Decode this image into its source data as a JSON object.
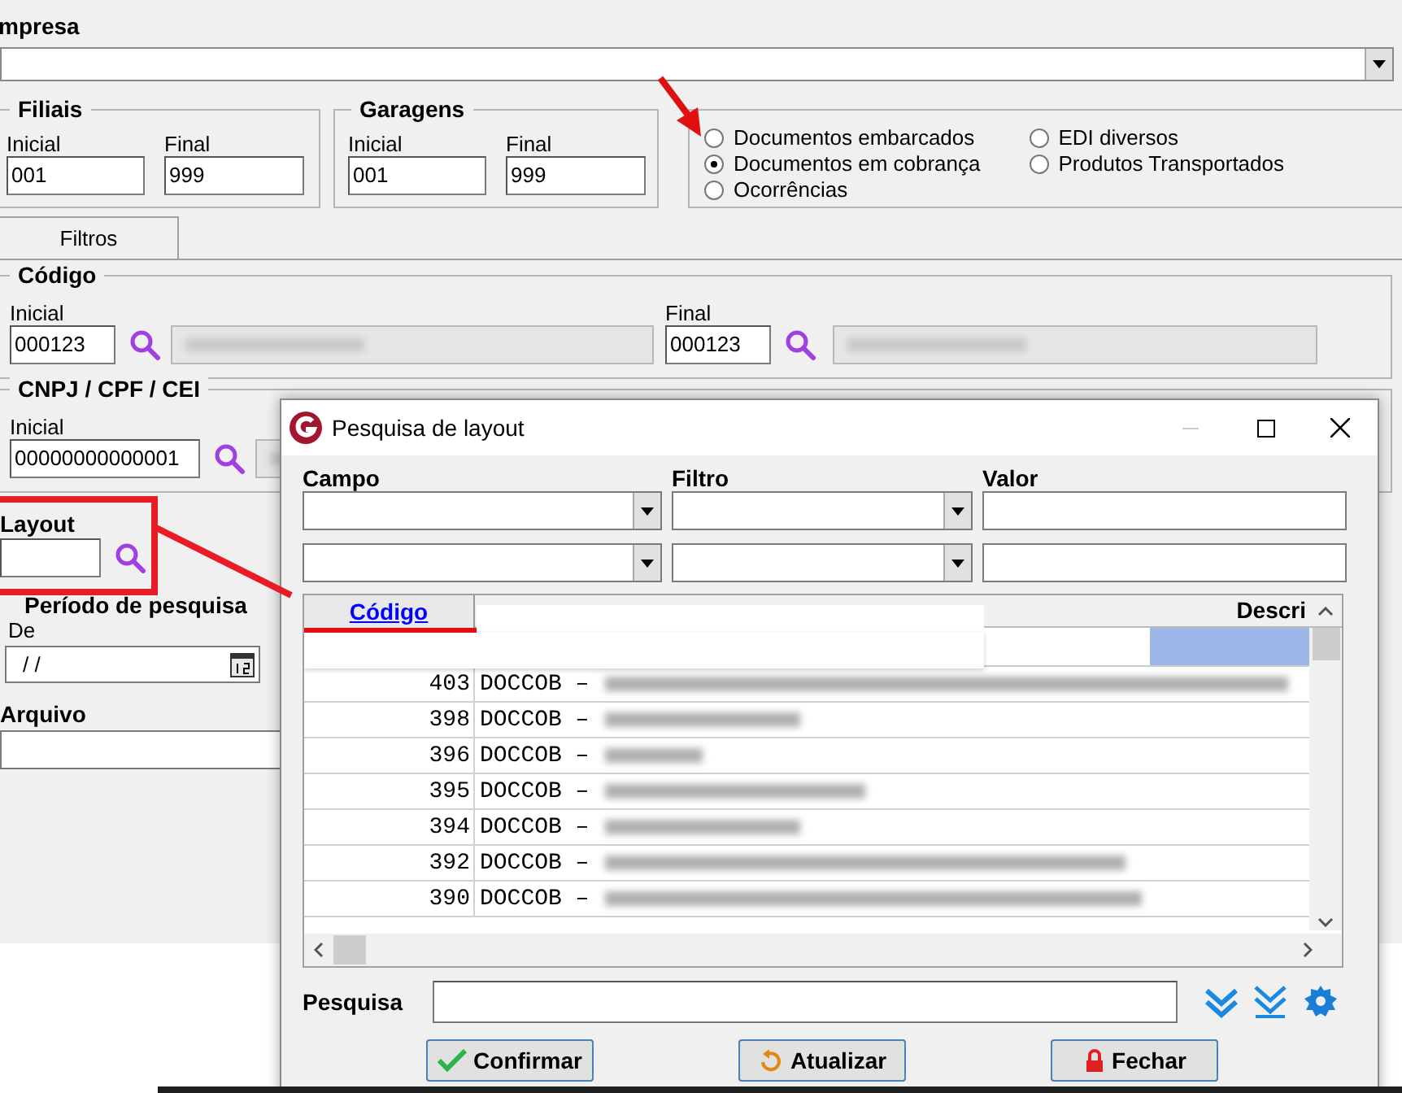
{
  "form": {
    "empresa_label": "mpresa",
    "filiais": {
      "title": "Filiais",
      "initial_label": "Inicial",
      "initial_value": "001",
      "final_label": "Final",
      "final_value": "999"
    },
    "garagens": {
      "title": "Garagens",
      "initial_label": "Inicial",
      "initial_value": "001",
      "final_label": "Final",
      "final_value": "999"
    },
    "document_types": [
      {
        "label": "Documentos embarcados",
        "selected": false
      },
      {
        "label": "Documentos em cobrança",
        "selected": true
      },
      {
        "label": "Ocorrências",
        "selected": false
      },
      {
        "label": "EDI diversos",
        "selected": false
      },
      {
        "label": "Produtos Transportados",
        "selected": false
      }
    ],
    "tabs": [
      {
        "label": "Filtros",
        "selected": true
      }
    ],
    "codigo": {
      "title": "Código",
      "initial_label": "Inicial",
      "initial_value": "000123",
      "final_label": "Final",
      "final_value": "000123"
    },
    "cnpj": {
      "title": "CNPJ / CPF / CEI",
      "initial_label": "Inicial",
      "initial_value": "00000000000001"
    },
    "layout": {
      "title": "Layout"
    },
    "periodo": {
      "title": "Período de pesquisa",
      "from_label": "De",
      "from_value": "/ /"
    },
    "arquivo": {
      "title": "Arquivo"
    }
  },
  "dialog": {
    "title": "Pesquisa de layout",
    "filter_labels": [
      "Campo",
      "Filtro",
      "Valor"
    ],
    "columns": [
      {
        "label": "Código",
        "sorted": true
      },
      {
        "label": "Descri",
        "sorted": false
      }
    ],
    "selected_row_visible": true,
    "rows": [
      {
        "code": "403",
        "description": "DOCCOB –"
      },
      {
        "code": "398",
        "description": "DOCCOB –"
      },
      {
        "code": "396",
        "description": "DOCCOB –"
      },
      {
        "code": "395",
        "description": "DOCCOB –"
      },
      {
        "code": "394",
        "description": "DOCCOB –"
      },
      {
        "code": "392",
        "description": "DOCCOB –"
      },
      {
        "code": "390",
        "description": "DOCCOB –"
      }
    ],
    "search_label": "Pesquisa",
    "buttons": [
      {
        "label": "Confirmar",
        "kind": "confirm"
      },
      {
        "label": "Atualizar",
        "kind": "refresh"
      },
      {
        "label": "Fechar",
        "kind": "close"
      }
    ]
  }
}
